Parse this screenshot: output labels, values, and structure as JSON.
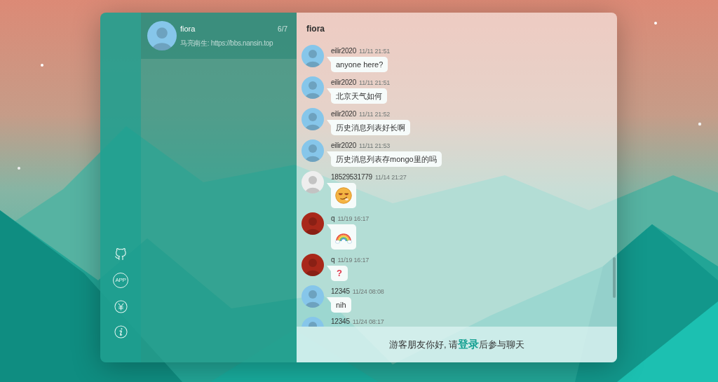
{
  "sidebar": {
    "buttons": [
      {
        "kind": "github"
      },
      {
        "kind": "app",
        "label": "APP"
      },
      {
        "kind": "reward"
      },
      {
        "kind": "about"
      }
    ]
  },
  "contacts": [
    {
      "name": "fiora",
      "time": "6/7",
      "preview": "马亮南生: https://bbs.nansin.top",
      "selected": true,
      "avatar": {
        "color": "#86c6ea"
      }
    }
  ],
  "chat": {
    "title": "fiora",
    "messages": [
      {
        "name": "eilir2020",
        "time": "11/11 21:51",
        "kind": "text",
        "content": "anyone here?",
        "avatar": {
          "color": "#86c6ea"
        }
      },
      {
        "name": "eilir2020",
        "time": "11/11 21:51",
        "kind": "text",
        "content": "北京天气如何",
        "avatar": {
          "color": "#86c6ea"
        }
      },
      {
        "name": "eilir2020",
        "time": "11/11 21:52",
        "kind": "text",
        "content": "历史消息列表好长啊",
        "avatar": {
          "color": "#86c6ea"
        }
      },
      {
        "name": "eilir2020",
        "time": "11/11 21:53",
        "kind": "text",
        "content": "历史消息列表存mongo里的吗",
        "avatar": {
          "color": "#86c6ea"
        }
      },
      {
        "name": "18529531779",
        "time": "11/14 21:27",
        "kind": "smirk",
        "avatar": {
          "color": "#eeeeee"
        }
      },
      {
        "name": "q",
        "time": "11/19 16:17",
        "kind": "rainbow",
        "avatar": {
          "color": "#a8281a"
        }
      },
      {
        "name": "q",
        "time": "11/19 16:17",
        "kind": "emoji",
        "content": "?",
        "avatar": {
          "color": "#a8281a"
        }
      },
      {
        "name": "12345",
        "time": "11/24 08:08",
        "kind": "text",
        "content": "nih",
        "avatar": {
          "color": "#86c6ea"
        }
      },
      {
        "name": "12345",
        "time": "11/24 08:17",
        "avatar": {
          "color": "#86c6ea"
        }
      }
    ]
  },
  "guest_notice": {
    "before": "游客朋友你好, 请",
    "link": "登录",
    "after": "后参与聊天"
  }
}
